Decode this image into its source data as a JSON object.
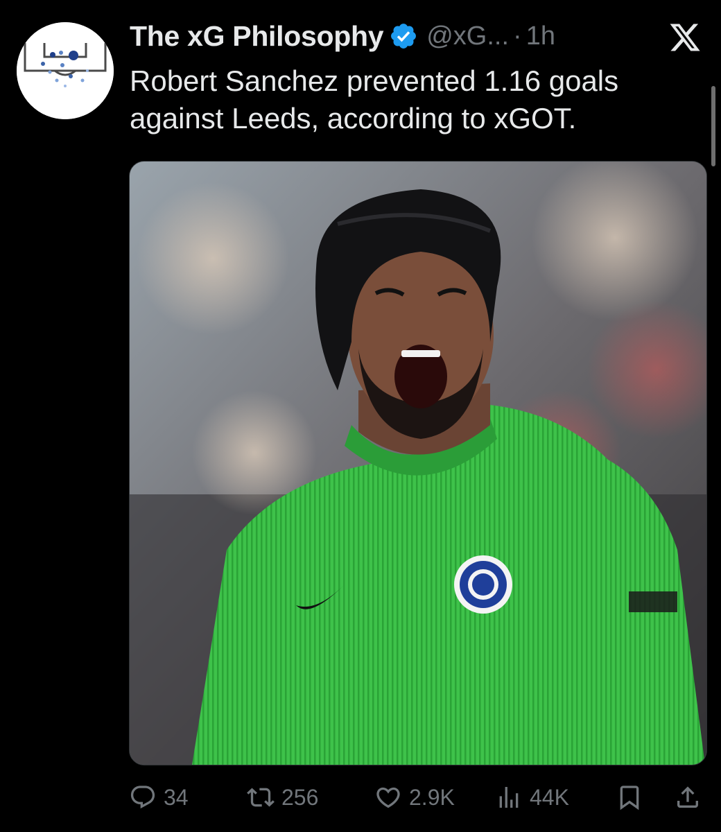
{
  "account": {
    "display_name": "The xG Philosophy",
    "verified_icon": "verified-badge-icon",
    "handle": "@xG...",
    "separator": "·",
    "time": "1h"
  },
  "tweet": {
    "text": "Robert Sanchez prevented 1.16 goals against Leeds, according to xGOT."
  },
  "media": {
    "icon": "photo-goalkeeper-celebrating"
  },
  "actions": {
    "reply": {
      "icon": "reply-icon",
      "count": "34"
    },
    "retweet": {
      "icon": "retweet-icon",
      "count": "256"
    },
    "like": {
      "icon": "heart-icon",
      "count": "2.9K"
    },
    "views": {
      "icon": "views-icon",
      "count": "44K"
    },
    "bookmark": {
      "icon": "bookmark-icon"
    },
    "share": {
      "icon": "share-icon"
    }
  },
  "colors": {
    "background": "#000000",
    "primary_text": "#e7e9ea",
    "secondary_text": "#71767b",
    "verified_blue": "#1d9bf0"
  }
}
